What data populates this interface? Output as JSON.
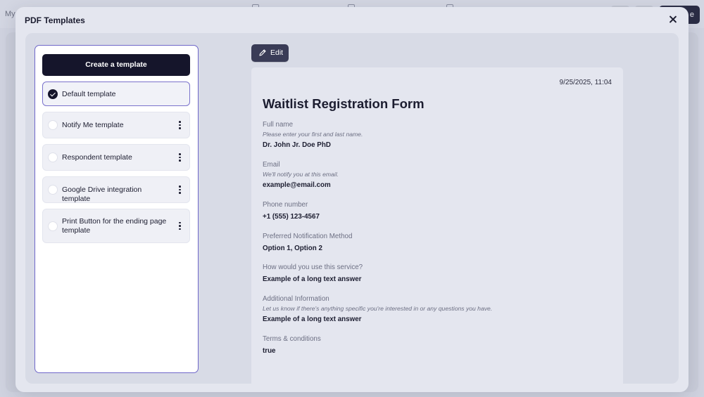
{
  "background": {
    "app_label": "My",
    "cta_label": "e"
  },
  "modal": {
    "title": "PDF Templates",
    "create_button": "Create a template",
    "edit_button": "Edit",
    "templates": [
      {
        "label": "Default template",
        "selected": true
      },
      {
        "label": "Notify Me template",
        "selected": false
      },
      {
        "label": "Respondent template",
        "selected": false
      },
      {
        "label": "Google Drive integration template",
        "selected": false
      },
      {
        "label": "Print Button for the ending page template",
        "selected": false
      }
    ]
  },
  "preview": {
    "date": "9/25/2025, 11:04",
    "form_title": "Waitlist Registration Form",
    "fields": [
      {
        "label": "Full name",
        "help": "Please enter your first and last name.",
        "value": "Dr. John Jr. Doe PhD"
      },
      {
        "label": "Email",
        "help": "We'll notify you at this email.",
        "value": "example@email.com"
      },
      {
        "label": "Phone number",
        "help": "",
        "value": "+1 (555) 123-4567"
      },
      {
        "label": "Preferred Notification Method",
        "help": "",
        "value": "Option 1, Option 2"
      },
      {
        "label": "How would you use this service?",
        "help": "",
        "value": "Example of a long text answer"
      },
      {
        "label": "Additional Information",
        "help": "Let us know if there's anything specific you're interested in or any questions you have.",
        "value": "Example of a long text answer"
      },
      {
        "label": "Terms & conditions",
        "help": "",
        "value": "true"
      }
    ]
  },
  "colors": {
    "accent": "#6f67c9",
    "primary_dark": "#15152b",
    "edit_button": "#3a3c57"
  },
  "icons": {
    "close": "close-icon",
    "check": "check-icon",
    "kebab": "kebab-menu-icon",
    "edit": "pencil-icon"
  }
}
